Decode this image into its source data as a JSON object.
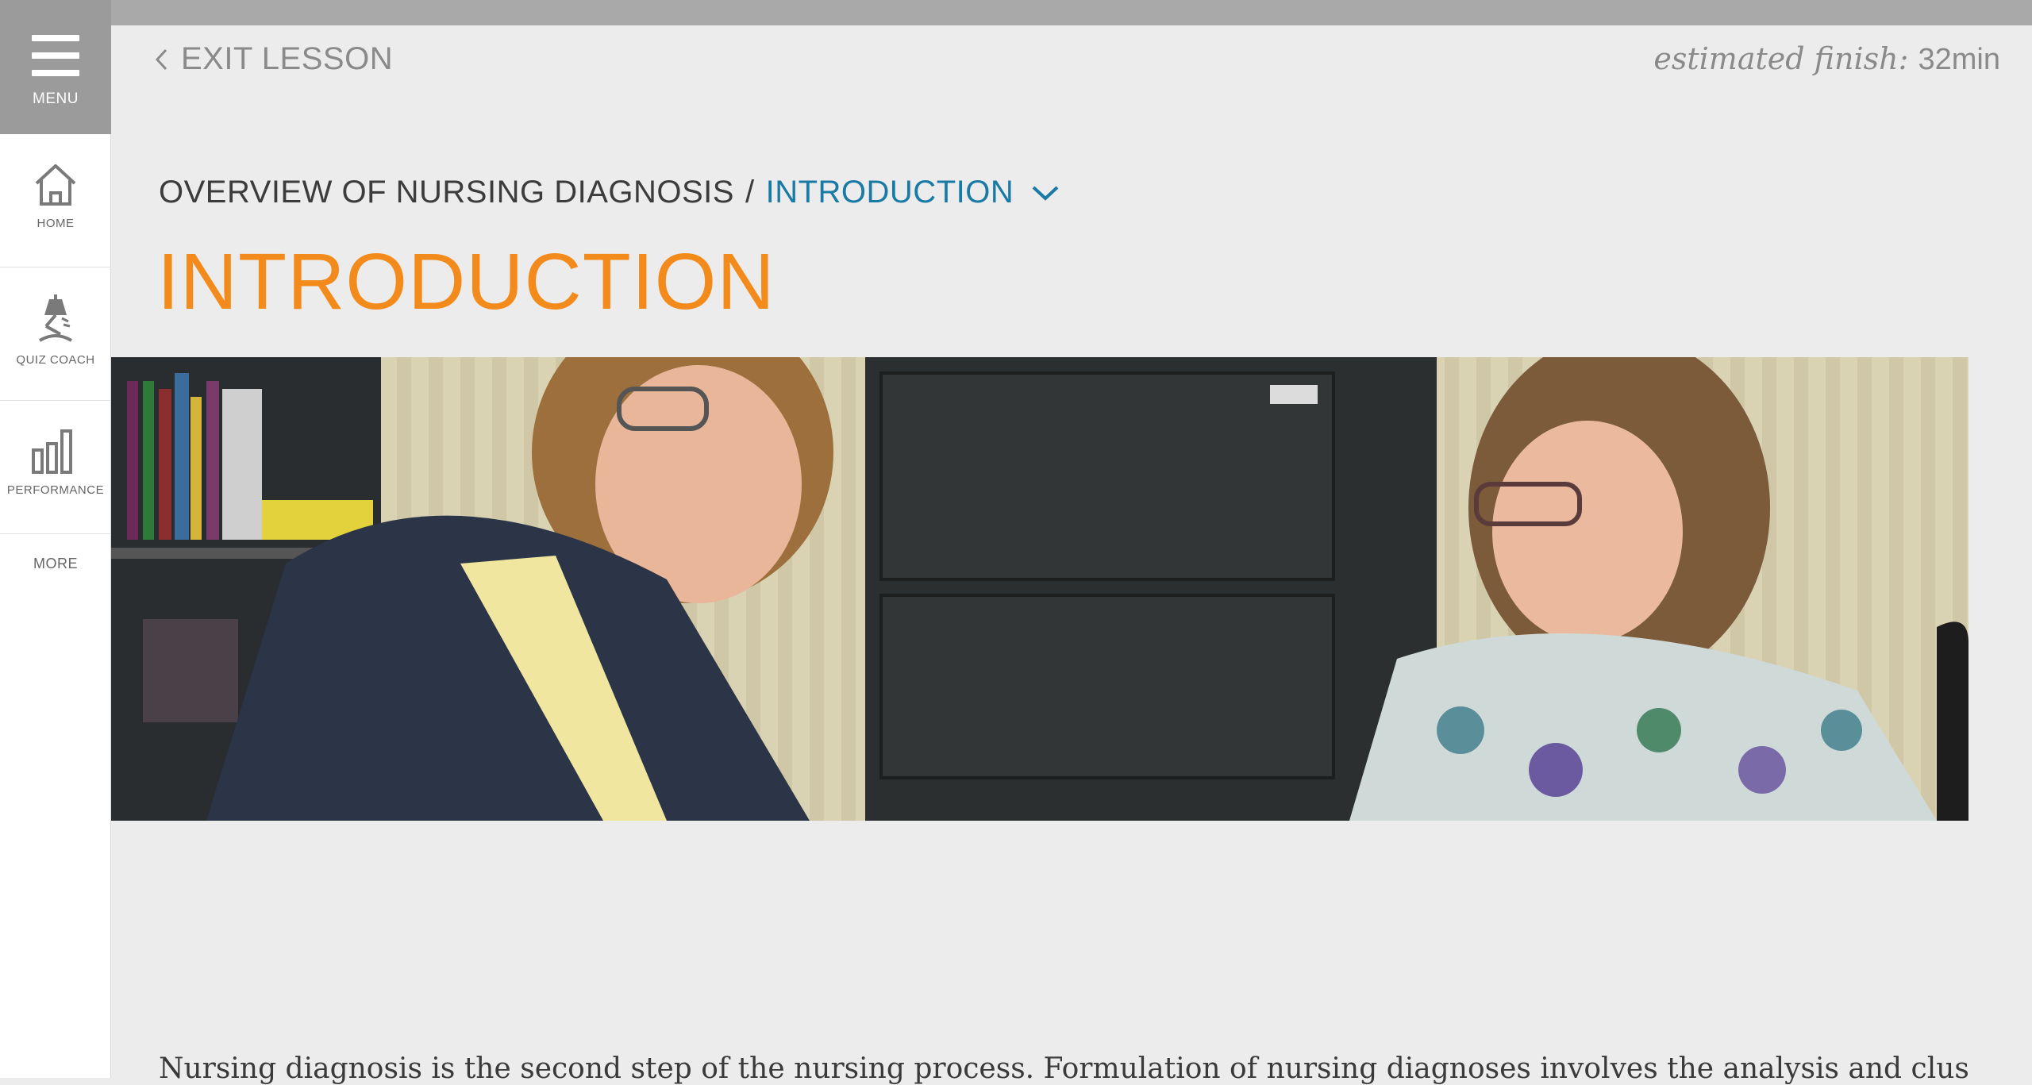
{
  "rail": {
    "menu_label": "MENU",
    "items": [
      {
        "label": "HOME",
        "icon": "home-icon"
      },
      {
        "label": "QUIZ COACH",
        "icon": "quiz-coach-icon"
      },
      {
        "label": "PERFORMANCE",
        "icon": "performance-icon"
      }
    ],
    "more_label": "MORE"
  },
  "header": {
    "exit_label": "EXIT LESSON",
    "estimated_label": "estimated finish:",
    "estimated_value": "32min"
  },
  "breadcrumb": {
    "parent": "OVERVIEW OF NURSING DIAGNOSIS",
    "separator": "/",
    "current": "INTRODUCTION"
  },
  "page": {
    "title": "INTRODUCTION",
    "body_first_line": "Nursing diagnosis is the second step of the nursing process. Formulation of nursing diagnoses involves the analysis and clustering of"
  },
  "colors": {
    "accent_orange": "#f38b1c",
    "link_blue": "#1a7aa6",
    "menu_gray": "#9b9b9b"
  }
}
